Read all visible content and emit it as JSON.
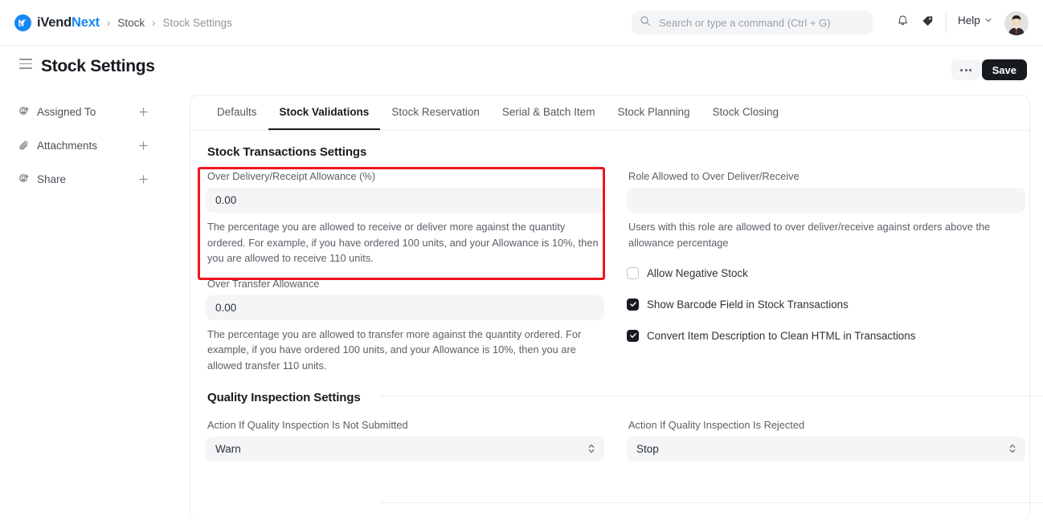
{
  "navbar": {
    "brand": {
      "first": "iVend",
      "second": "Next",
      "logo_icon": "ivendnext-logo-icon"
    },
    "breadcrumb": [
      {
        "label": "Stock",
        "muted": false
      },
      {
        "label": "Stock Settings",
        "muted": true
      }
    ],
    "search": {
      "placeholder": "Search or type a command (Ctrl + G)",
      "value": "",
      "icon": "search-icon"
    },
    "bell_icon": "bell-icon",
    "tag_icon": "tag-icon",
    "help": {
      "label": "Help",
      "chevron": "chevron-down-icon"
    },
    "avatar_icon": "user-avatar-icon"
  },
  "page": {
    "title": "Stock Settings",
    "menu_icon": "hamburger-menu-icon",
    "more_label": "...",
    "save_label": "Save"
  },
  "sidebar": {
    "items": [
      {
        "label": "Assigned To",
        "icon": "assign-user-icon",
        "add_icon": "plus-icon"
      },
      {
        "label": "Attachments",
        "icon": "paperclip-icon",
        "add_icon": "plus-icon"
      },
      {
        "label": "Share",
        "icon": "share-user-icon",
        "add_icon": "plus-icon"
      }
    ]
  },
  "tabs": [
    {
      "label": "Defaults",
      "active": false
    },
    {
      "label": "Stock Validations",
      "active": true
    },
    {
      "label": "Stock Reservation",
      "active": false
    },
    {
      "label": "Serial & Batch Item",
      "active": false
    },
    {
      "label": "Stock Planning",
      "active": false
    },
    {
      "label": "Stock Closing",
      "active": false
    }
  ],
  "stock_transactions": {
    "title": "Stock Transactions Settings",
    "over_delivery": {
      "label": "Over Delivery/Receipt Allowance (%)",
      "value": "0.00",
      "help": "The percentage you are allowed to receive or deliver more against the quantity ordered. For example, if you have ordered 100 units, and your Allowance is 10%, then you are allowed to receive 110 units.",
      "highlighted": true,
      "highlight_color": "#f0141e"
    },
    "over_transfer": {
      "label": "Over Transfer Allowance",
      "value": "0.00",
      "help": "The percentage you are allowed to transfer more against the quantity ordered. For example, if you have ordered 100 units, and your Allowance is 10%, then you are allowed transfer 110 units."
    },
    "role_allowed": {
      "label": "Role Allowed to Over Deliver/Receive",
      "value": "",
      "placeholder": "",
      "help": "Users with this role are allowed to over deliver/receive against orders above the allowance percentage"
    },
    "checkboxes": [
      {
        "label": "Allow Negative Stock",
        "checked": false
      },
      {
        "label": "Show Barcode Field in Stock Transactions",
        "checked": true
      },
      {
        "label": "Convert Item Description to Clean HTML in Transactions",
        "checked": true
      }
    ]
  },
  "quality_inspection": {
    "title": "Quality Inspection Settings",
    "not_submitted": {
      "label": "Action If Quality Inspection Is Not Submitted",
      "value": "Warn",
      "options": [
        "Stop",
        "Warn"
      ]
    },
    "rejected": {
      "label": "Action If Quality Inspection Is Rejected",
      "value": "Stop",
      "options": [
        "Stop",
        "Warn"
      ]
    }
  }
}
